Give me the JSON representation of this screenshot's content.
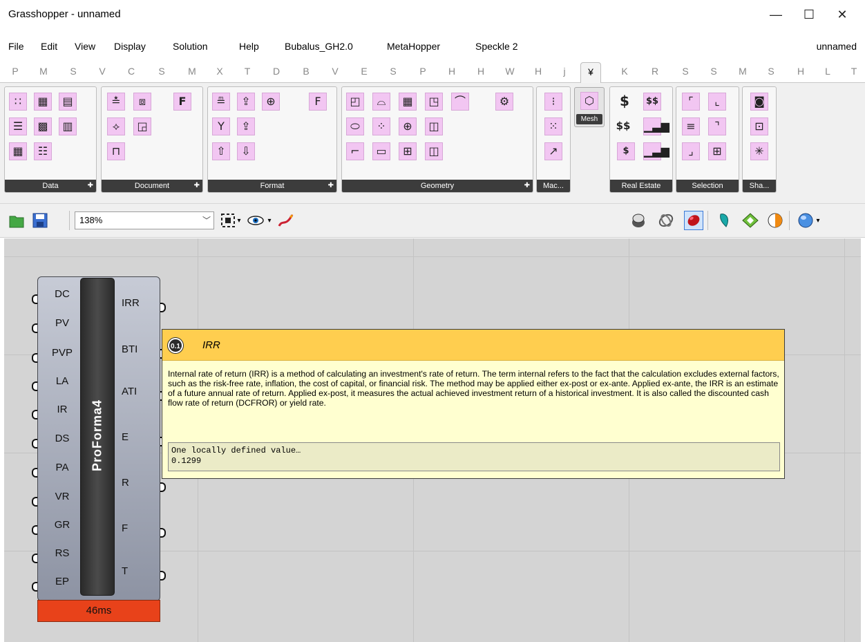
{
  "window": {
    "title": "Grasshopper - unnamed",
    "minimize": "—",
    "maximize": "☐",
    "close": "✕"
  },
  "menu": {
    "items": [
      "File",
      "Edit",
      "View",
      "Display",
      "Solution",
      "Help",
      "Bubalus_GH2.0",
      "MetaHopper",
      "Speckle 2"
    ],
    "document_name": "unnamed"
  },
  "tabs": [
    "P",
    "M",
    "S",
    "V",
    "C",
    "S",
    "M",
    "X",
    "T",
    "D",
    "B",
    "V",
    "E",
    "S",
    "P",
    "H",
    "H",
    "W",
    "H",
    "j",
    "¥",
    "K",
    "R",
    "S",
    "S",
    "M",
    "S",
    "H",
    "L",
    "T"
  ],
  "active_tab_index": 20,
  "ribbon": {
    "groups": [
      "Data",
      "Document",
      "Format",
      "Geometry",
      "Mac...",
      "Real Estate",
      "Selection",
      "Sha..."
    ],
    "mesh_label": "Mesh",
    "real_estate_icons": [
      "$",
      "$$",
      "$$",
      "$"
    ]
  },
  "toolbar": {
    "zoom": "138%"
  },
  "component": {
    "name": "ProForma4",
    "inputs": [
      "DC",
      "PV",
      "PVP",
      "LA",
      "IR",
      "DS",
      "PA",
      "VR",
      "GR",
      "RS",
      "EP"
    ],
    "outputs": [
      "IRR",
      "BTI",
      "ATI",
      "E",
      "R",
      "F",
      "T"
    ],
    "time": "46ms"
  },
  "tooltip": {
    "badge": "0.1",
    "title": "IRR",
    "description": "Internal rate of return (IRR) is a method of calculating an investment's rate of return. The term internal refers to the fact that the calculation excludes external factors, such as the risk-free rate, inflation, the cost of capital, or financial risk. The method may be applied either ex-post or ex-ante. Applied ex-ante, the IRR is an estimate of a future annual rate of return. Applied ex-post, it measures the actual achieved investment return of a historical investment. It is also called the discounted cash flow rate of return (DCFROR) or yield rate.",
    "value_header": "One locally defined value…",
    "value": "0.1299"
  },
  "colors": {
    "ribbon_icon": "#f2c6f2",
    "tooltip_header": "#ffce4f",
    "tooltip_body": "#ffffd0",
    "time_bar": "#e8421a",
    "canvas": "#d4d4d4"
  }
}
